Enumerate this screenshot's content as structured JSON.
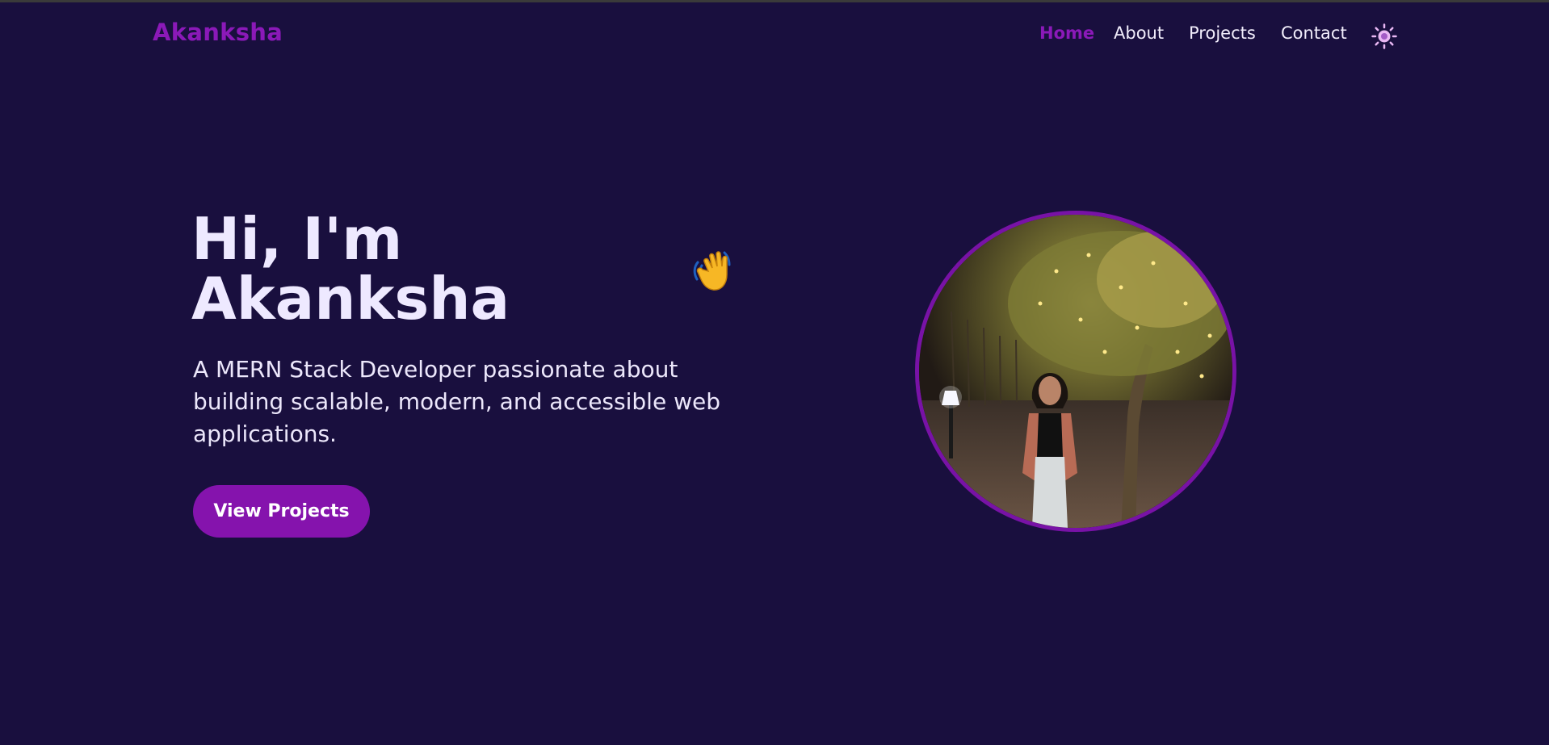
{
  "header": {
    "brand": "Akanksha",
    "nav": [
      {
        "label": "Home",
        "active": true
      },
      {
        "label": "About",
        "active": false
      },
      {
        "label": "Projects",
        "active": false
      },
      {
        "label": "Contact",
        "active": false
      }
    ],
    "theme_toggle_icon": "sun-icon"
  },
  "hero": {
    "title_line1": "Hi, I'm",
    "title_line2": "Akanksha",
    "wave_icon": "waving-hand-icon",
    "subtitle": "A MERN Stack Developer passionate about building scalable, modern, and accessible web applications.",
    "cta_label": "View Projects",
    "profile_image": "profile-photo"
  },
  "colors": {
    "background": "#190f3e",
    "accent": "#8b19b8",
    "text": "#ece8fb",
    "button": "#8513ad"
  }
}
